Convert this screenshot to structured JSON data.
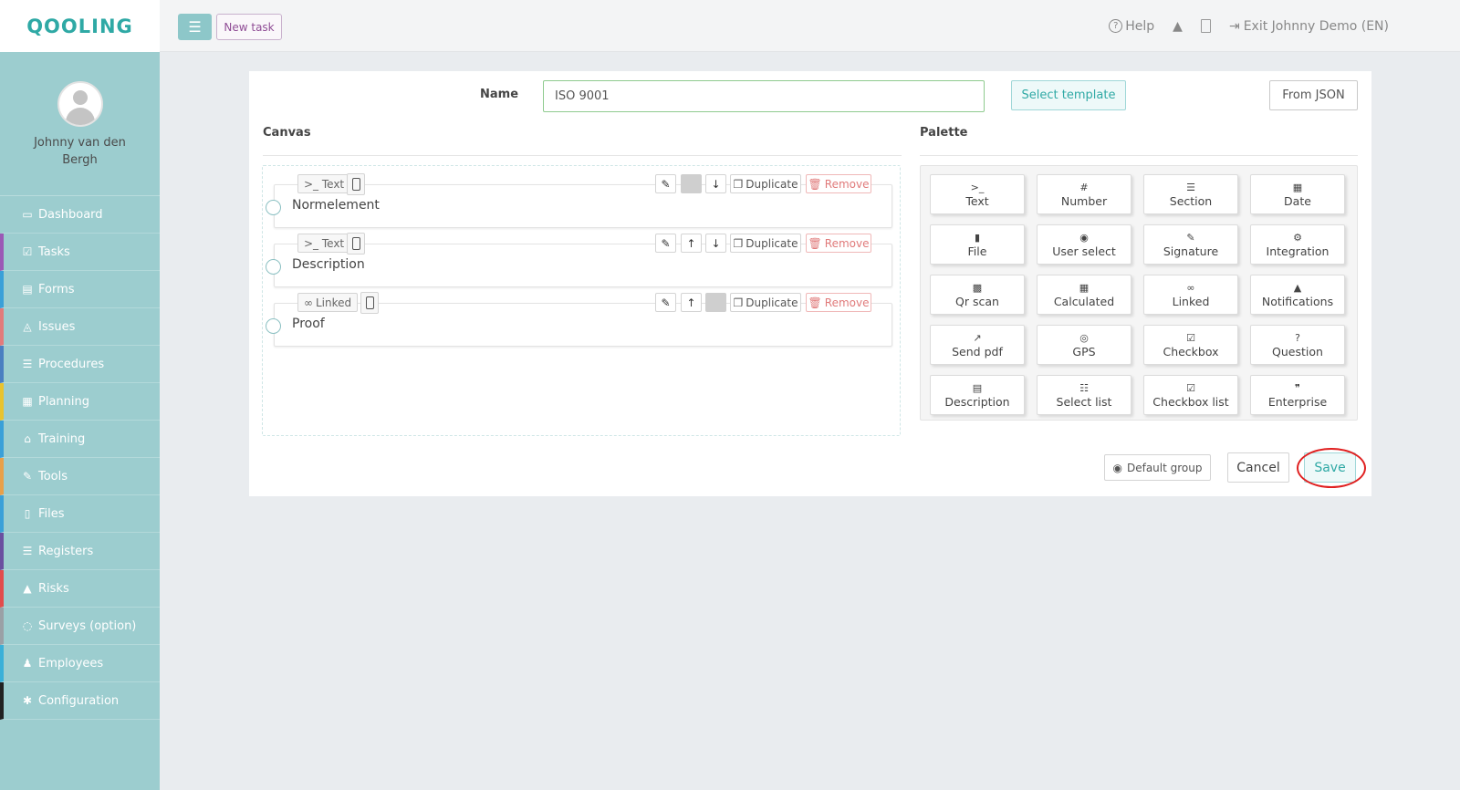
{
  "app": {
    "logo": "QOOLING"
  },
  "user": {
    "name": "Johnny van den Bergh"
  },
  "sidebar": {
    "items": [
      {
        "label": "Dashboard",
        "icon": "monitor-icon",
        "glyph": "▭",
        "accent": "#9ccdcf"
      },
      {
        "label": "Tasks",
        "icon": "check-square-icon",
        "glyph": "☑",
        "accent": "#9b59b6"
      },
      {
        "label": "Forms",
        "icon": "file-text-icon",
        "glyph": "▤",
        "accent": "#3aa0d8"
      },
      {
        "label": "Issues",
        "icon": "bell-icon",
        "glyph": "◬",
        "accent": "#e27b7b"
      },
      {
        "label": "Procedures",
        "icon": "list-icon",
        "glyph": "☰",
        "accent": "#4a7fc1"
      },
      {
        "label": "Planning",
        "icon": "calendar-icon",
        "glyph": "▦",
        "accent": "#e8c32e"
      },
      {
        "label": "Training",
        "icon": "graduation-cap-icon",
        "glyph": "⌂",
        "accent": "#3aa0d8"
      },
      {
        "label": "Tools",
        "icon": "wrench-icon",
        "glyph": "✎",
        "accent": "#e8a04a"
      },
      {
        "label": "Files",
        "icon": "file-pdf-icon",
        "glyph": "▯",
        "accent": "#3aa0d8"
      },
      {
        "label": "Registers",
        "icon": "list-icon",
        "glyph": "☰",
        "accent": "#6a4fa0"
      },
      {
        "label": "Risks",
        "icon": "warning-icon",
        "glyph": "▲",
        "accent": "#e24c4c"
      },
      {
        "label": "Surveys (option)",
        "icon": "comments-icon",
        "glyph": "◌",
        "accent": "#9aa0a6"
      },
      {
        "label": "Employees",
        "icon": "users-icon",
        "glyph": "♟",
        "accent": "#3ab0d8"
      },
      {
        "label": "Configuration",
        "icon": "gear-icon",
        "glyph": "✱",
        "accent": "#222222"
      }
    ]
  },
  "topbar": {
    "new_task": "New task",
    "help": "Help",
    "exit": "Exit Johnny Demo (EN)"
  },
  "form": {
    "name_label": "Name",
    "name_value": "ISO 9001",
    "select_template": "Select template",
    "from_json": "From JSON",
    "canvas_title": "Canvas",
    "palette_title": "Palette"
  },
  "canvas": {
    "fields": [
      {
        "type": ">_ Text",
        "label": "Normelement",
        "duplicate": "Duplicate",
        "remove": "Remove"
      },
      {
        "type": ">_ Text",
        "label": "Description",
        "duplicate": "Duplicate",
        "remove": "Remove"
      },
      {
        "type": "Linked",
        "label": "Proof",
        "duplicate": "Duplicate",
        "remove": "Remove"
      }
    ]
  },
  "palette": {
    "items": [
      {
        "label": "Text",
        "icon": "terminal-icon",
        "glyph": ">_"
      },
      {
        "label": "Number",
        "icon": "hash-icon",
        "glyph": "#"
      },
      {
        "label": "Section",
        "icon": "list-icon",
        "glyph": "☰"
      },
      {
        "label": "Date",
        "icon": "calendar-icon",
        "glyph": "▦"
      },
      {
        "label": "File",
        "icon": "file-icon",
        "glyph": "▮"
      },
      {
        "label": "User select",
        "icon": "user-circle-icon",
        "glyph": "◉"
      },
      {
        "label": "Signature",
        "icon": "pen-square-icon",
        "glyph": "✎"
      },
      {
        "label": "Integration",
        "icon": "cogs-icon",
        "glyph": "⚙"
      },
      {
        "label": "Qr scan",
        "icon": "qrcode-icon",
        "glyph": "▩"
      },
      {
        "label": "Calculated",
        "icon": "calculator-icon",
        "glyph": "▦"
      },
      {
        "label": "Linked",
        "icon": "link-icon",
        "glyph": "∞"
      },
      {
        "label": "Notifications",
        "icon": "bell-icon",
        "glyph": "▲"
      },
      {
        "label": "Send pdf",
        "icon": "share-square-icon",
        "glyph": "↗"
      },
      {
        "label": "GPS",
        "icon": "compass-icon",
        "glyph": "◎"
      },
      {
        "label": "Checkbox",
        "icon": "check-square-icon",
        "glyph": "☑"
      },
      {
        "label": "Question",
        "icon": "question-circle-icon",
        "glyph": "?"
      },
      {
        "label": "Description",
        "icon": "file-text-icon",
        "glyph": "▤"
      },
      {
        "label": "Select list",
        "icon": "list-ol-icon",
        "glyph": "☷"
      },
      {
        "label": "Checkbox list",
        "icon": "check-square-icon",
        "glyph": "☑"
      },
      {
        "label": "Enterprise",
        "icon": "quote-icon",
        "glyph": "❞"
      }
    ]
  },
  "actions": {
    "default_group": "Default group",
    "cancel": "Cancel",
    "save": "Save"
  }
}
